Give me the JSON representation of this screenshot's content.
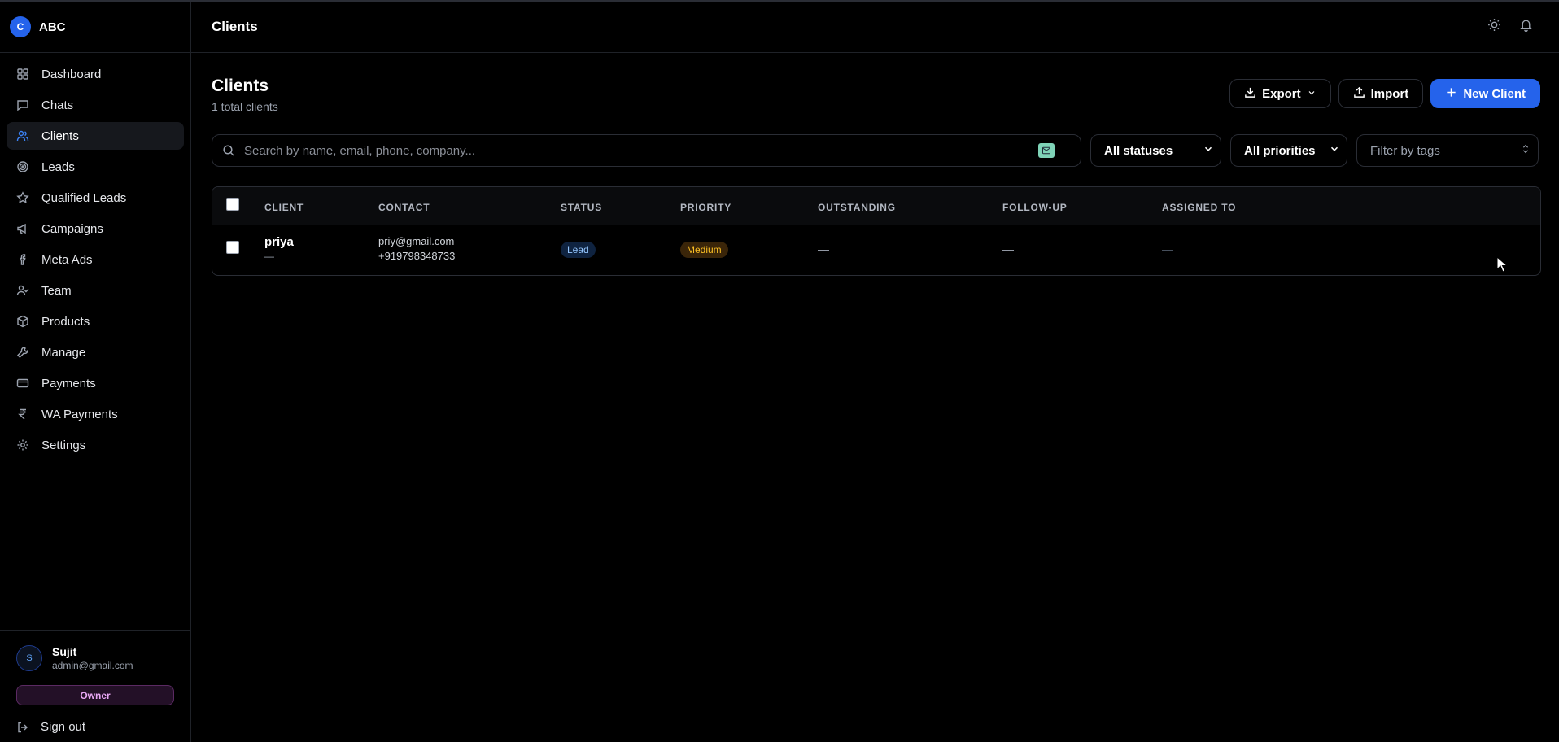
{
  "brand": {
    "logo_letter": "C",
    "name": "ABC",
    "color": "#2563eb"
  },
  "sidebar": {
    "items": [
      {
        "label": "Dashboard",
        "icon": "grid-icon"
      },
      {
        "label": "Chats",
        "icon": "chat-icon"
      },
      {
        "label": "Clients",
        "icon": "users-icon",
        "active": true
      },
      {
        "label": "Leads",
        "icon": "target-icon"
      },
      {
        "label": "Qualified Leads",
        "icon": "star-icon"
      },
      {
        "label": "Campaigns",
        "icon": "megaphone-icon"
      },
      {
        "label": "Meta Ads",
        "icon": "facebook-icon"
      },
      {
        "label": "Team",
        "icon": "user-check-icon"
      },
      {
        "label": "Products",
        "icon": "box-icon"
      },
      {
        "label": "Manage",
        "icon": "wrench-icon"
      },
      {
        "label": "Payments",
        "icon": "credit-card-icon"
      },
      {
        "label": "WA Payments",
        "icon": "rupee-icon"
      },
      {
        "label": "Settings",
        "icon": "gear-icon"
      }
    ]
  },
  "user": {
    "avatar_letter": "S",
    "name": "Sujit",
    "email": "admin@gmail.com",
    "role": "Owner"
  },
  "sign_out_label": "Sign out",
  "topbar": {
    "title": "Clients"
  },
  "page": {
    "title": "Clients",
    "subtitle": "1 total clients"
  },
  "actions": {
    "export_label": "Export",
    "import_label": "Import",
    "new_client_label": "New Client"
  },
  "filters": {
    "search_placeholder": "Search by name, email, phone, company...",
    "status_value": "All statuses",
    "priority_value": "All priorities",
    "tags_placeholder": "Filter by tags"
  },
  "table": {
    "columns": [
      "CLIENT",
      "CONTACT",
      "STATUS",
      "PRIORITY",
      "OUTSTANDING",
      "FOLLOW-UP",
      "ASSIGNED TO"
    ],
    "rows": [
      {
        "client_name": "priya",
        "client_company": "—",
        "email": "priy@gmail.com",
        "phone": "+919798348733",
        "status": "Lead",
        "priority": "Medium",
        "outstanding": "—",
        "follow_up": "—",
        "assigned_to": "—"
      }
    ]
  },
  "colors": {
    "accent": "#2563eb",
    "status_lead": "#93c5fd",
    "priority_medium": "#fbbf24",
    "owner_badge": "#e9a8f5"
  }
}
